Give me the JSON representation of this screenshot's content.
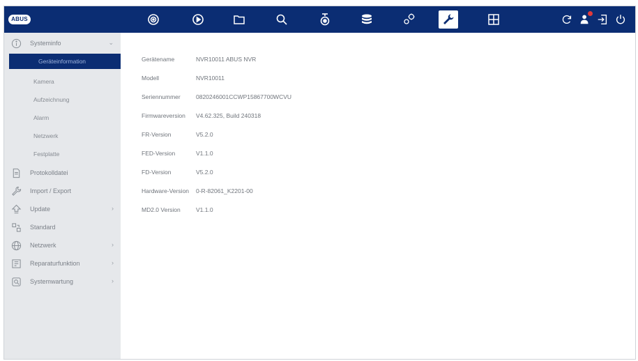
{
  "topbar": {
    "logo": "ABUS",
    "nav": [
      {
        "name": "live-view-icon",
        "label": ""
      },
      {
        "name": "playback-icon",
        "label": ""
      },
      {
        "name": "file-icon",
        "label": ""
      },
      {
        "name": "search-icon",
        "label": ""
      },
      {
        "name": "camera-icon",
        "label": ""
      },
      {
        "name": "storage-icon",
        "label": ""
      },
      {
        "name": "settings-icon",
        "label": ""
      },
      {
        "name": "maintenance-wrench-icon",
        "label": "",
        "active": true
      },
      {
        "name": "grid-icon",
        "label": ""
      }
    ],
    "right_icons": [
      "refresh-icon",
      "user-icon",
      "logout-icon",
      "power-icon"
    ]
  },
  "sidebar": {
    "items": [
      {
        "label": "Systeminfo",
        "icon": "info-icon",
        "chevron": "⌄"
      },
      {
        "label": "Geräteinformation",
        "sub": true,
        "selected": true
      },
      {
        "label": "Kamera",
        "sub": true
      },
      {
        "label": "Aufzeichnung",
        "sub": true
      },
      {
        "label": "Alarm",
        "sub": true
      },
      {
        "label": "Netzwerk",
        "sub": true
      },
      {
        "label": "Festplatte",
        "sub": true
      },
      {
        "label": "Protokolldatei",
        "icon": "document-icon"
      },
      {
        "label": "Import / Export",
        "icon": "wrench-icon"
      },
      {
        "label": "Update",
        "icon": "upload-icon",
        "chevron": "›"
      },
      {
        "label": "Standard",
        "icon": "default-icon"
      },
      {
        "label": "Netzwerk",
        "icon": "globe-icon",
        "chevron": "›"
      },
      {
        "label": "Reparaturfunktion",
        "icon": "repair-icon",
        "chevron": "›"
      },
      {
        "label": "Systemwartung",
        "icon": "maintenance-icon",
        "chevron": "›"
      }
    ]
  },
  "info": [
    {
      "key": "Gerätename",
      "value": "NVR10011 ABUS NVR"
    },
    {
      "key": "Modell",
      "value": "NVR10011"
    },
    {
      "key": "Seriennummer",
      "value": "0820246001CCWP15867700WCVU"
    },
    {
      "key": "Firmwareversion",
      "value": "V4.62.325, Build 240318"
    },
    {
      "key": "FR-Version",
      "value": "V5.2.0"
    },
    {
      "key": "FED-Version",
      "value": "V1.1.0"
    },
    {
      "key": "FD-Version",
      "value": "V5.2.0"
    },
    {
      "key": "Hardware-Version",
      "value": "0-R-82061_K2201-00"
    },
    {
      "key": "MD2.0 Version",
      "value": "V1.1.0"
    }
  ]
}
